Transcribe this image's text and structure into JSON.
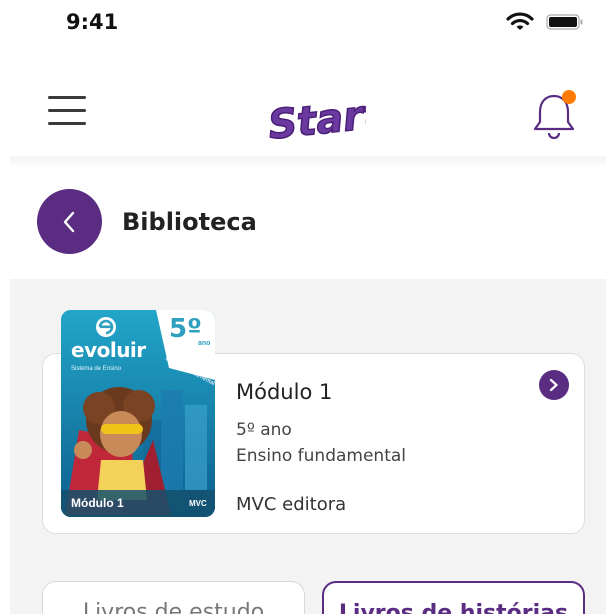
{
  "status": {
    "time": "9:41"
  },
  "header": {
    "logo_text": "Start"
  },
  "page": {
    "title": "Biblioteca"
  },
  "book": {
    "title": "Módulo 1",
    "grade": "5º ano",
    "level": "Ensino fundamental",
    "publisher": "MVC editora",
    "cover": {
      "brand": "evoluir",
      "brand_sub": "Sistema de Ensino",
      "grade_badge": "5º",
      "grade_badge_sub": "ano",
      "level_tag": "Ensino Fundamental",
      "module_label": "Módulo 1",
      "publisher_mark": "MVC"
    }
  },
  "tabs": [
    {
      "label": "Livros de estudo"
    },
    {
      "label": "Livros de histórias"
    }
  ],
  "colors": {
    "accent": "#5a2d82",
    "notification": "#ff7a00",
    "cover_teal": "#2f9fbf"
  }
}
